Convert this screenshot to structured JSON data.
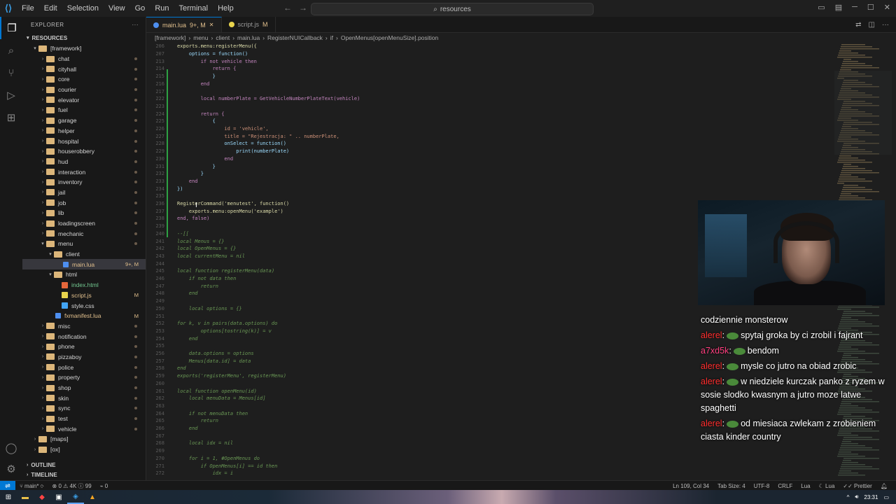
{
  "titlebar": {
    "menu": [
      "File",
      "Edit",
      "Selection",
      "View",
      "Go",
      "Run",
      "Terminal",
      "Help"
    ],
    "search": "resources"
  },
  "sidebar": {
    "title": "EXPLORER",
    "root": "RESOURCES",
    "items": [
      {
        "label": "[framework]",
        "depth": 1,
        "type": "folder",
        "open": true
      },
      {
        "label": "chat",
        "depth": 2,
        "type": "folder"
      },
      {
        "label": "cityhall",
        "depth": 2,
        "type": "folder"
      },
      {
        "label": "core",
        "depth": 2,
        "type": "folder"
      },
      {
        "label": "courier",
        "depth": 2,
        "type": "folder"
      },
      {
        "label": "elevator",
        "depth": 2,
        "type": "folder"
      },
      {
        "label": "fuel",
        "depth": 2,
        "type": "folder"
      },
      {
        "label": "garage",
        "depth": 2,
        "type": "folder"
      },
      {
        "label": "helper",
        "depth": 2,
        "type": "folder"
      },
      {
        "label": "hospital",
        "depth": 2,
        "type": "folder"
      },
      {
        "label": "houserobbery",
        "depth": 2,
        "type": "folder"
      },
      {
        "label": "hud",
        "depth": 2,
        "type": "folder"
      },
      {
        "label": "interaction",
        "depth": 2,
        "type": "folder"
      },
      {
        "label": "inventory",
        "depth": 2,
        "type": "folder"
      },
      {
        "label": "jail",
        "depth": 2,
        "type": "folder"
      },
      {
        "label": "job",
        "depth": 2,
        "type": "folder"
      },
      {
        "label": "lib",
        "depth": 2,
        "type": "folder"
      },
      {
        "label": "loadingscreen",
        "depth": 2,
        "type": "folder"
      },
      {
        "label": "mechanic",
        "depth": 2,
        "type": "folder"
      },
      {
        "label": "menu",
        "depth": 2,
        "type": "folder",
        "open": true
      },
      {
        "label": "client",
        "depth": 3,
        "type": "folder",
        "open": true
      },
      {
        "label": "main.lua",
        "depth": 4,
        "type": "lua",
        "mark": "9+, M",
        "selected": true
      },
      {
        "label": "html",
        "depth": 3,
        "type": "folder",
        "open": true
      },
      {
        "label": "index.html",
        "depth": 4,
        "type": "html",
        "untracked": true
      },
      {
        "label": "script.js",
        "depth": 4,
        "type": "js",
        "mark": "M"
      },
      {
        "label": "style.css",
        "depth": 4,
        "type": "css"
      },
      {
        "label": "fxmanifest.lua",
        "depth": 3,
        "type": "lua",
        "mark": "M"
      },
      {
        "label": "misc",
        "depth": 2,
        "type": "folder"
      },
      {
        "label": "notification",
        "depth": 2,
        "type": "folder"
      },
      {
        "label": "phone",
        "depth": 2,
        "type": "folder"
      },
      {
        "label": "pizzaboy",
        "depth": 2,
        "type": "folder"
      },
      {
        "label": "police",
        "depth": 2,
        "type": "folder"
      },
      {
        "label": "property",
        "depth": 2,
        "type": "folder"
      },
      {
        "label": "shop",
        "depth": 2,
        "type": "folder"
      },
      {
        "label": "skin",
        "depth": 2,
        "type": "folder"
      },
      {
        "label": "sync",
        "depth": 2,
        "type": "folder"
      },
      {
        "label": "test",
        "depth": 2,
        "type": "folder"
      },
      {
        "label": "vehicle",
        "depth": 2,
        "type": "folder"
      },
      {
        "label": "[maps]",
        "depth": 1,
        "type": "folder"
      },
      {
        "label": "[ox]",
        "depth": 1,
        "type": "folder"
      }
    ],
    "outline": "OUTLINE",
    "timeline": "TIMELINE"
  },
  "tabs": [
    {
      "label": "main.lua",
      "suffix": "9+, M",
      "active": true
    },
    {
      "label": "script.js",
      "suffix": "M",
      "active": false
    }
  ],
  "breadcrumb": [
    "[framework]",
    "menu",
    "client",
    "main.lua",
    "RegisterNUICallback",
    "if",
    "OpenMenus[openMenuSize].position"
  ],
  "code": [
    {
      "n": "206",
      "t": "exports.menu:registerMenu({"
    },
    {
      "n": "207",
      "t": "    options = function()"
    },
    {
      "n": "213",
      "t": "        if not vehicle then"
    },
    {
      "n": "214",
      "t": "            return {"
    },
    {
      "n": "215",
      "t": "            }"
    },
    {
      "n": "216",
      "t": "        end"
    },
    {
      "n": "217",
      "t": ""
    },
    {
      "n": "222",
      "t": "        local numberPlate = GetVehicleNumberPlateText(vehicle)"
    },
    {
      "n": "223",
      "t": ""
    },
    {
      "n": "224",
      "t": "        return {"
    },
    {
      "n": "225",
      "t": "            {"
    },
    {
      "n": "226",
      "t": "                id = 'vehicle',"
    },
    {
      "n": "227",
      "t": "                title = \"Rejestracja: \" .. numberPlate,"
    },
    {
      "n": "228",
      "t": "                onSelect = function()"
    },
    {
      "n": "229",
      "t": "                    print(numberPlate)"
    },
    {
      "n": "230",
      "t": "                end"
    },
    {
      "n": "231",
      "t": "            }"
    },
    {
      "n": "232",
      "t": "        }"
    },
    {
      "n": "233",
      "t": "    end"
    },
    {
      "n": "234",
      "t": "})"
    },
    {
      "n": "235",
      "t": ""
    },
    {
      "n": "236",
      "t": "RegisterCommand('menutest', function()"
    },
    {
      "n": "237",
      "t": "    exports.menu:openMenu('example')"
    },
    {
      "n": "238",
      "t": "end, false)"
    },
    {
      "n": "239",
      "t": ""
    },
    {
      "n": "240",
      "t": "--[["
    },
    {
      "n": "241",
      "t": "local Menus = {}"
    },
    {
      "n": "242",
      "t": "local OpenMenus = {}"
    },
    {
      "n": "243",
      "t": "local currentMenu = nil"
    },
    {
      "n": "244",
      "t": ""
    },
    {
      "n": "245",
      "t": "local function registerMenu(data)"
    },
    {
      "n": "246",
      "t": "    if not data then"
    },
    {
      "n": "247",
      "t": "        return"
    },
    {
      "n": "248",
      "t": "    end"
    },
    {
      "n": "249",
      "t": ""
    },
    {
      "n": "250",
      "t": "    local options = {}"
    },
    {
      "n": "251",
      "t": ""
    },
    {
      "n": "252",
      "t": "for k, v in pairs(data.options) do"
    },
    {
      "n": "253",
      "t": "        options[tostring(k)] = v"
    },
    {
      "n": "254",
      "t": "    end"
    },
    {
      "n": "255",
      "t": ""
    },
    {
      "n": "256",
      "t": "    data.options = options"
    },
    {
      "n": "257",
      "t": "    Menus[data.id] = data"
    },
    {
      "n": "258",
      "t": "end"
    },
    {
      "n": "259",
      "t": "exports('registerMenu', registerMenu)"
    },
    {
      "n": "260",
      "t": ""
    },
    {
      "n": "261",
      "t": "local function openMenu(id)"
    },
    {
      "n": "262",
      "t": "    local menuData = Menus[id]"
    },
    {
      "n": "263",
      "t": ""
    },
    {
      "n": "264",
      "t": "    if not menuData then"
    },
    {
      "n": "265",
      "t": "        return"
    },
    {
      "n": "266",
      "t": "    end"
    },
    {
      "n": "267",
      "t": ""
    },
    {
      "n": "268",
      "t": "    local idx = nil"
    },
    {
      "n": "269",
      "t": ""
    },
    {
      "n": "270",
      "t": "    for i = 1, #OpenMenus do"
    },
    {
      "n": "271",
      "t": "        if OpenMenus[i] == id then"
    },
    {
      "n": "272",
      "t": "            idx = i"
    }
  ],
  "chat": [
    {
      "user": "",
      "text": "codziennie monsterow"
    },
    {
      "user": "alerel",
      "text": "spytaj groka by ci zrobil i fajrant"
    },
    {
      "user": "a7xd5k",
      "text": "bendom"
    },
    {
      "user": "alerel",
      "text": "mysle co jutro na obiad zrobic"
    },
    {
      "user": "alerel",
      "text": "w niedziele kurczak panko z ryzem w sosie slodko kwasnym a jutro moze latwe spaghetti"
    },
    {
      "user": "alerel",
      "text": "od miesiaca zwlekam z zrobieniem ciasta kinder country"
    }
  ],
  "status": {
    "branch": "main*",
    "errors": "0",
    "warnings": "4K",
    "info": "99",
    "ports": "0",
    "position": "Ln 109, Col 34",
    "tabsize": "Tab Size: 4",
    "encoding": "UTF-8",
    "eol": "CRLF",
    "language": "Lua",
    "lang2": "Lua",
    "prettier": "Prettier"
  },
  "clock": "23:31",
  "colors": {
    "accent": "#0078d4",
    "modified": "#e2c08d",
    "chat_user": "#ff2d2d"
  }
}
